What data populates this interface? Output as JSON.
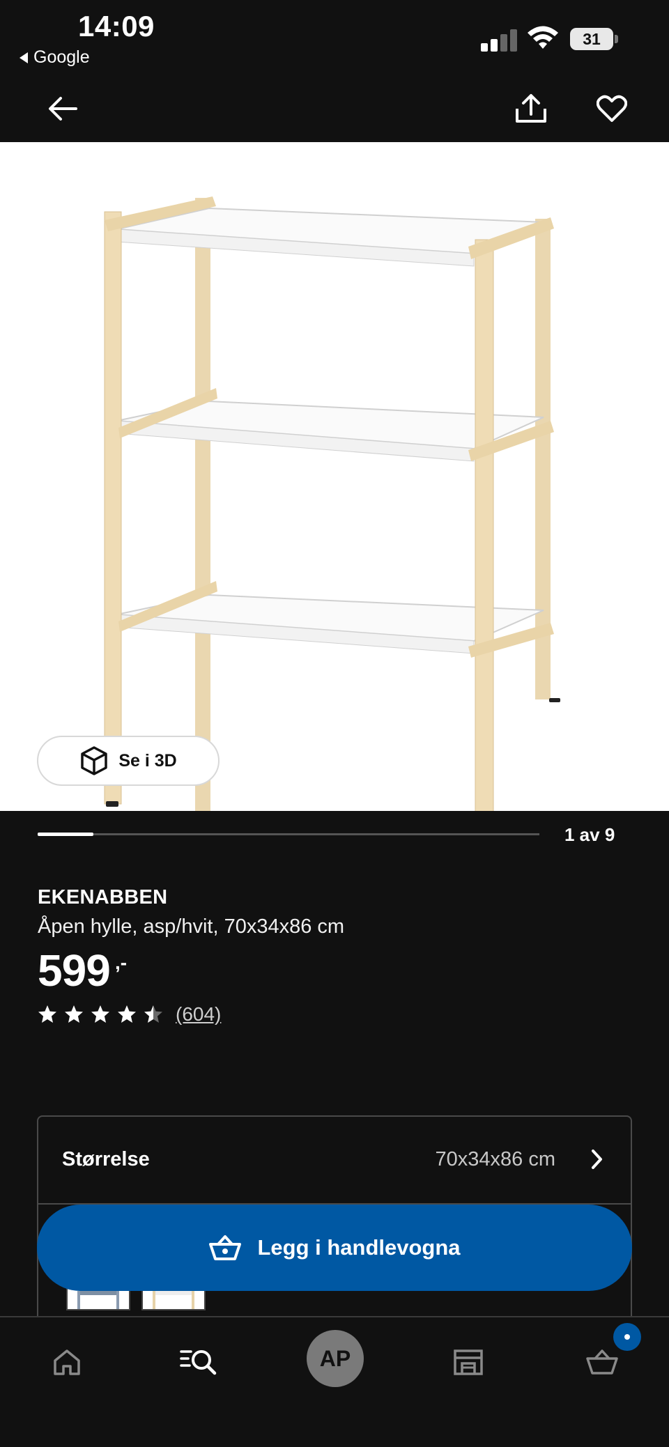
{
  "status_bar": {
    "time": "14:09",
    "back_app": "Google",
    "battery": "31"
  },
  "nav": {
    "back_icon": "arrow-left-icon",
    "share_icon": "share-icon",
    "favorite_icon": "heart-icon"
  },
  "gallery": {
    "view_3d_label": "Se i 3D",
    "counter": "1 av 9",
    "current": 1,
    "total": 9
  },
  "product": {
    "name": "EKENABBEN",
    "description": "Åpen hylle, asp/hvit, 70x34x86 cm",
    "price": "599",
    "price_suffix": ",-",
    "rating": 4.5,
    "review_count": "(604)"
  },
  "size_selector": {
    "label": "Størrelse",
    "value": "70x34x86 cm"
  },
  "add_to_cart": {
    "label": "Legg i handlevogna"
  },
  "tab_bar": {
    "avatar_initials": "AP",
    "items": [
      "home-icon",
      "search-icon",
      "avatar",
      "store-icon",
      "cart-icon"
    ]
  },
  "colors": {
    "background": "#111111",
    "primary_blue": "#0058a3",
    "avatar_gray": "#7a7a7a"
  }
}
